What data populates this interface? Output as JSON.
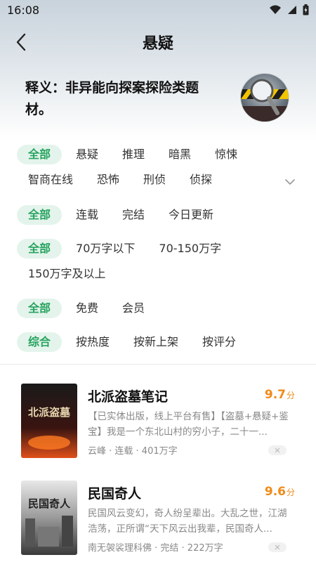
{
  "status": {
    "time": "16:08"
  },
  "nav": {
    "title": "悬疑"
  },
  "description": "释义：非异能向探案探险类题材。",
  "filters": {
    "category": {
      "active": "全部",
      "row1": [
        "悬疑",
        "推理",
        "暗黑",
        "惊悚"
      ],
      "row2": [
        "智商在线",
        "恐怖",
        "刑侦",
        "侦探"
      ]
    },
    "status": {
      "active": "全部",
      "options": [
        "连载",
        "完结",
        "今日更新"
      ]
    },
    "length": {
      "active": "全部",
      "options": [
        "70万字以下",
        "70-150万字"
      ],
      "options_row2": [
        "150万字及以上"
      ]
    },
    "price": {
      "active": "全部",
      "options": [
        "免费",
        "会员"
      ]
    },
    "sort": {
      "active": "综合",
      "options": [
        "按热度",
        "按新上架",
        "按评分"
      ]
    }
  },
  "books": [
    {
      "title": "北派盗墓笔记",
      "score": "9.7",
      "score_unit": "分",
      "intro": "【已实体出版，线上平台有售】【盗墓+悬疑+鉴宝】我是一个东北山村的穷小子，二十一...",
      "meta": "云峰 · 连载 · 401万字",
      "cover_text": "北派盗墓"
    },
    {
      "title": "民国奇人",
      "score": "9.6",
      "score_unit": "分",
      "intro": "民国风云变幻，奇人纷呈辈出。大乱之世，江湖浩荡，正所谓“天下风云出我辈，民国奇人...",
      "meta": "南无袈裟理科佛 · 完结 · 222万字",
      "cover_text": "民国奇人"
    }
  ],
  "colors": {
    "accent": "#27a35f",
    "chip_bg": "#e4f4ec",
    "score": "#f08a18"
  },
  "icons": [
    "wifi-icon",
    "signal-icon",
    "battery-icon",
    "back-arrow-icon",
    "chevron-down-icon",
    "close-icon"
  ]
}
